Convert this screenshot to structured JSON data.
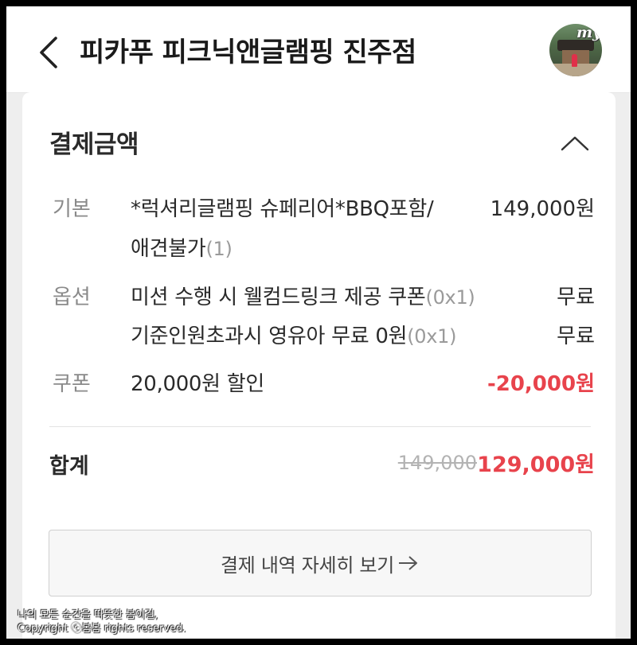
{
  "header": {
    "title": "피카푸 피크닉앤글램핑 진주점",
    "avatar_badge": "my"
  },
  "payment": {
    "section_title": "결제금액",
    "rows": [
      {
        "label": "기본",
        "line1": "*럭셔리글램핑 슈페리어*BBQ포함/",
        "line2": "애견불가",
        "qty": "(1)",
        "value": "149,000원"
      },
      {
        "label": "옵션",
        "line1": "미션 수행 시 웰컴드링크 제공 쿠폰",
        "qty1": "(0x1)",
        "value1": "무료",
        "line2": "기준인원초과시 영유아 무료 0원",
        "qty2": "(0x1)",
        "value2": "무료"
      },
      {
        "label": "쿠폰",
        "line1": "20,000원 할인",
        "value": "-20,000원"
      }
    ],
    "total_label": "합계",
    "original_price": "149,000",
    "final_price": "129,000원",
    "detail_button": "결제 내역 자세히 보기"
  },
  "watermark": {
    "line1": "나의 모든 순간을 따뜻한 봄이길,",
    "line2": "Copyright ⓒ봄봄 rights reserved."
  },
  "colors": {
    "accent": "#e8434c",
    "background": "#eeeeee",
    "card": "#ffffff"
  },
  "icons": [
    "back-arrow-icon",
    "chevron-up-icon",
    "arrow-right-icon"
  ]
}
